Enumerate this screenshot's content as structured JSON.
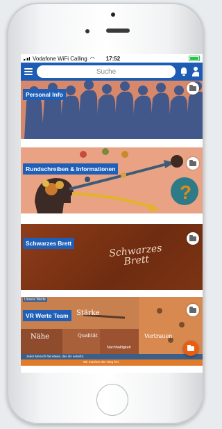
{
  "status_bar": {
    "carrier": "Vodafone WiFi Calling",
    "time": "17:52"
  },
  "app_bar": {
    "search_placeholder": "Suche"
  },
  "cards": [
    {
      "label": "Personal Info",
      "icon": "folder-icon"
    },
    {
      "label": "Rundschreiben & Informationen",
      "icon": "folder-icon"
    },
    {
      "label": "Schwarzes Brett",
      "icon": "folder-icon",
      "image_text": [
        "Schwarzes",
        "Brett"
      ]
    },
    {
      "label": "VR Werte Team",
      "icon": "folder-icon",
      "image_text": {
        "top_tag": "Unsere Werte",
        "w1": "Nähe",
        "w2": "Qualität",
        "w3": "Vertrauen",
        "w4": "Nachhaltigkeit",
        "w5": "Stärke",
        "caption1": "Jeder Mensch hat etwas, das ihn antreibt.",
        "caption2": "Wir machen den Weg frei."
      }
    }
  ],
  "colors": {
    "accent": "#1e5cb4",
    "fab": "#e85d0f"
  }
}
